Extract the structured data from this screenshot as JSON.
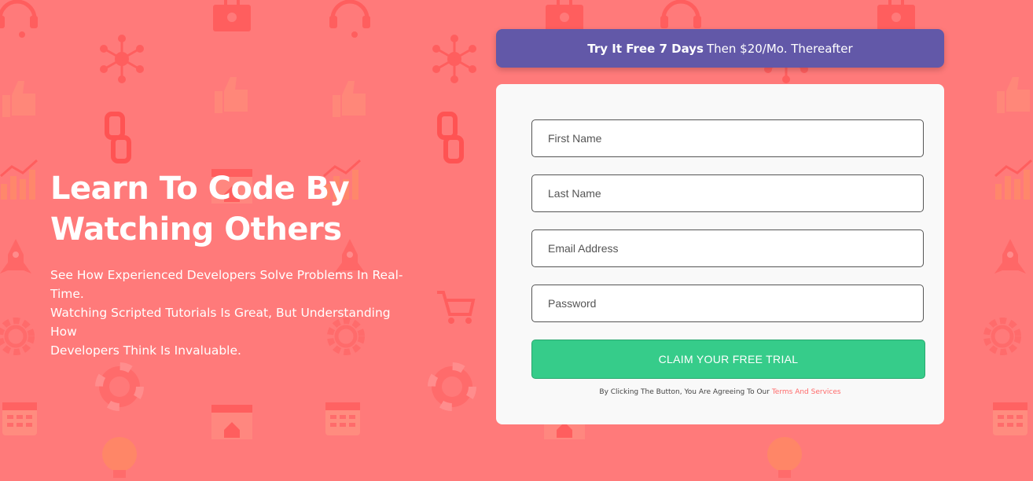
{
  "colors": {
    "background": "#ff7a7a",
    "promo_bar": "#6258a8",
    "button": "#36cc8a",
    "terms_link": "#ff6a6a",
    "card": "#f9f9f9"
  },
  "hero": {
    "title_line1": "Learn To Code By",
    "title_line2": "Watching Others",
    "desc_line1": "See How Experienced Developers Solve Problems In Real-Time.",
    "desc_line2": "Watching Scripted Tutorials Is Great, But Understanding How",
    "desc_line3": "Developers Think Is Invaluable."
  },
  "promo": {
    "bold": "Try It Free 7 Days",
    "rest": "Then $20/Mo. Thereafter"
  },
  "form": {
    "first_name_placeholder": "First Name",
    "last_name_placeholder": "Last Name",
    "email_placeholder": "Email Address",
    "password_placeholder": "Password",
    "submit_label": "CLAIM YOUR FREE TRIAL",
    "terms_prefix": "By Clicking The Button, You Are Agreeing To Our",
    "terms_link": "Terms And Services"
  },
  "background_icons": [
    "headset-icon",
    "network-icon",
    "thumbs-up-icon",
    "chain-link-icon",
    "bar-chart-icon",
    "rocket-icon",
    "gear-icon",
    "lifebuoy-icon",
    "calendar-icon",
    "lightbulb-icon",
    "toolbox-icon",
    "browser-icon",
    "cart-icon"
  ]
}
